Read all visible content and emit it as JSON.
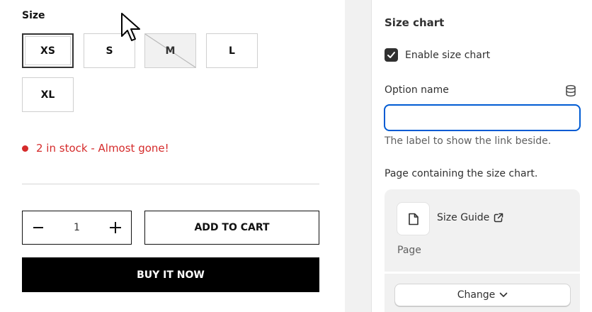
{
  "product": {
    "size_label": "Size",
    "sizes": [
      {
        "label": "XS",
        "state": "selected"
      },
      {
        "label": "S",
        "state": "available"
      },
      {
        "label": "M",
        "state": "sold-out"
      },
      {
        "label": "L",
        "state": "available"
      },
      {
        "label": "XL",
        "state": "available"
      }
    ],
    "stock_text": "2 in stock - Almost gone!",
    "quantity": "1",
    "add_to_cart": "ADD TO CART",
    "buy_now": "BUY IT NOW"
  },
  "panel": {
    "title": "Size chart",
    "enable_label": "Enable size chart",
    "enable_checked": true,
    "option_name_label": "Option name",
    "option_name_value": "",
    "option_help": "The label to show the link beside.",
    "page_section_label": "Page containing the size chart.",
    "page_name": "Size Guide",
    "page_type": "Page",
    "change_label": "Change"
  },
  "colors": {
    "stock_red": "#d52b2b",
    "focus_blue": "#005bd3",
    "panel_gray": "#f1f1f1"
  },
  "icons": [
    "pointer-cursor-icon",
    "minus-icon",
    "plus-icon",
    "checkmark-icon",
    "database-icon",
    "page-icon",
    "external-link-icon",
    "chevron-down-icon"
  ]
}
